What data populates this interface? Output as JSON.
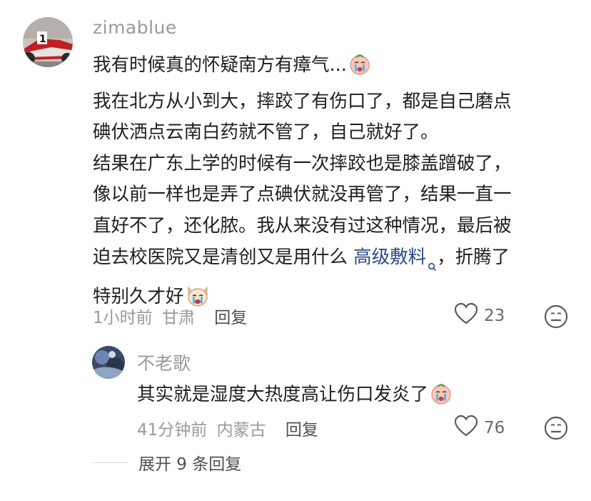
{
  "comment": {
    "username": "zimablue",
    "text_lines": [
      "我有时候真的怀疑南方有瘴气...",
      "我在北方从小到大，摔跤了有伤口了，都是自己磨点",
      "碘伏洒点云南白药就不管了，自己就好了。",
      "结果在广东上学的时候有一次摔跤也是膝盖蹭破了，",
      "像以前一样也是弄了点碘伏就没再管了，结果一直一",
      "直好不了，还化脓。我从来没有过这种情况，最后被",
      "迫去校医院又是清创又是用什么 ",
      "，折腾了",
      "特别久才好"
    ],
    "link_text": "高级敷料",
    "time": "1小时前",
    "location": "甘肃",
    "reply_label": "回复",
    "likes": "23"
  },
  "reply": {
    "username": "不老歌",
    "text": "其实就是湿度大热度高让伤口发炎了",
    "time": "41分钟前",
    "location": "内蒙古",
    "reply_label": "回复",
    "likes": "76"
  },
  "expand_label": "展开 9 条回复",
  "icons": {
    "like": "heart-outline-icon",
    "dislike": "meh-face-icon",
    "emoji1": "crying-emoji",
    "emoji2": "crying-dog-emoji",
    "emoji3": "crying-emoji",
    "link": "search-icon"
  },
  "colors": {
    "link": "#2b4a86",
    "meta": "#9a9a9a",
    "text": "#1f1f1f"
  }
}
